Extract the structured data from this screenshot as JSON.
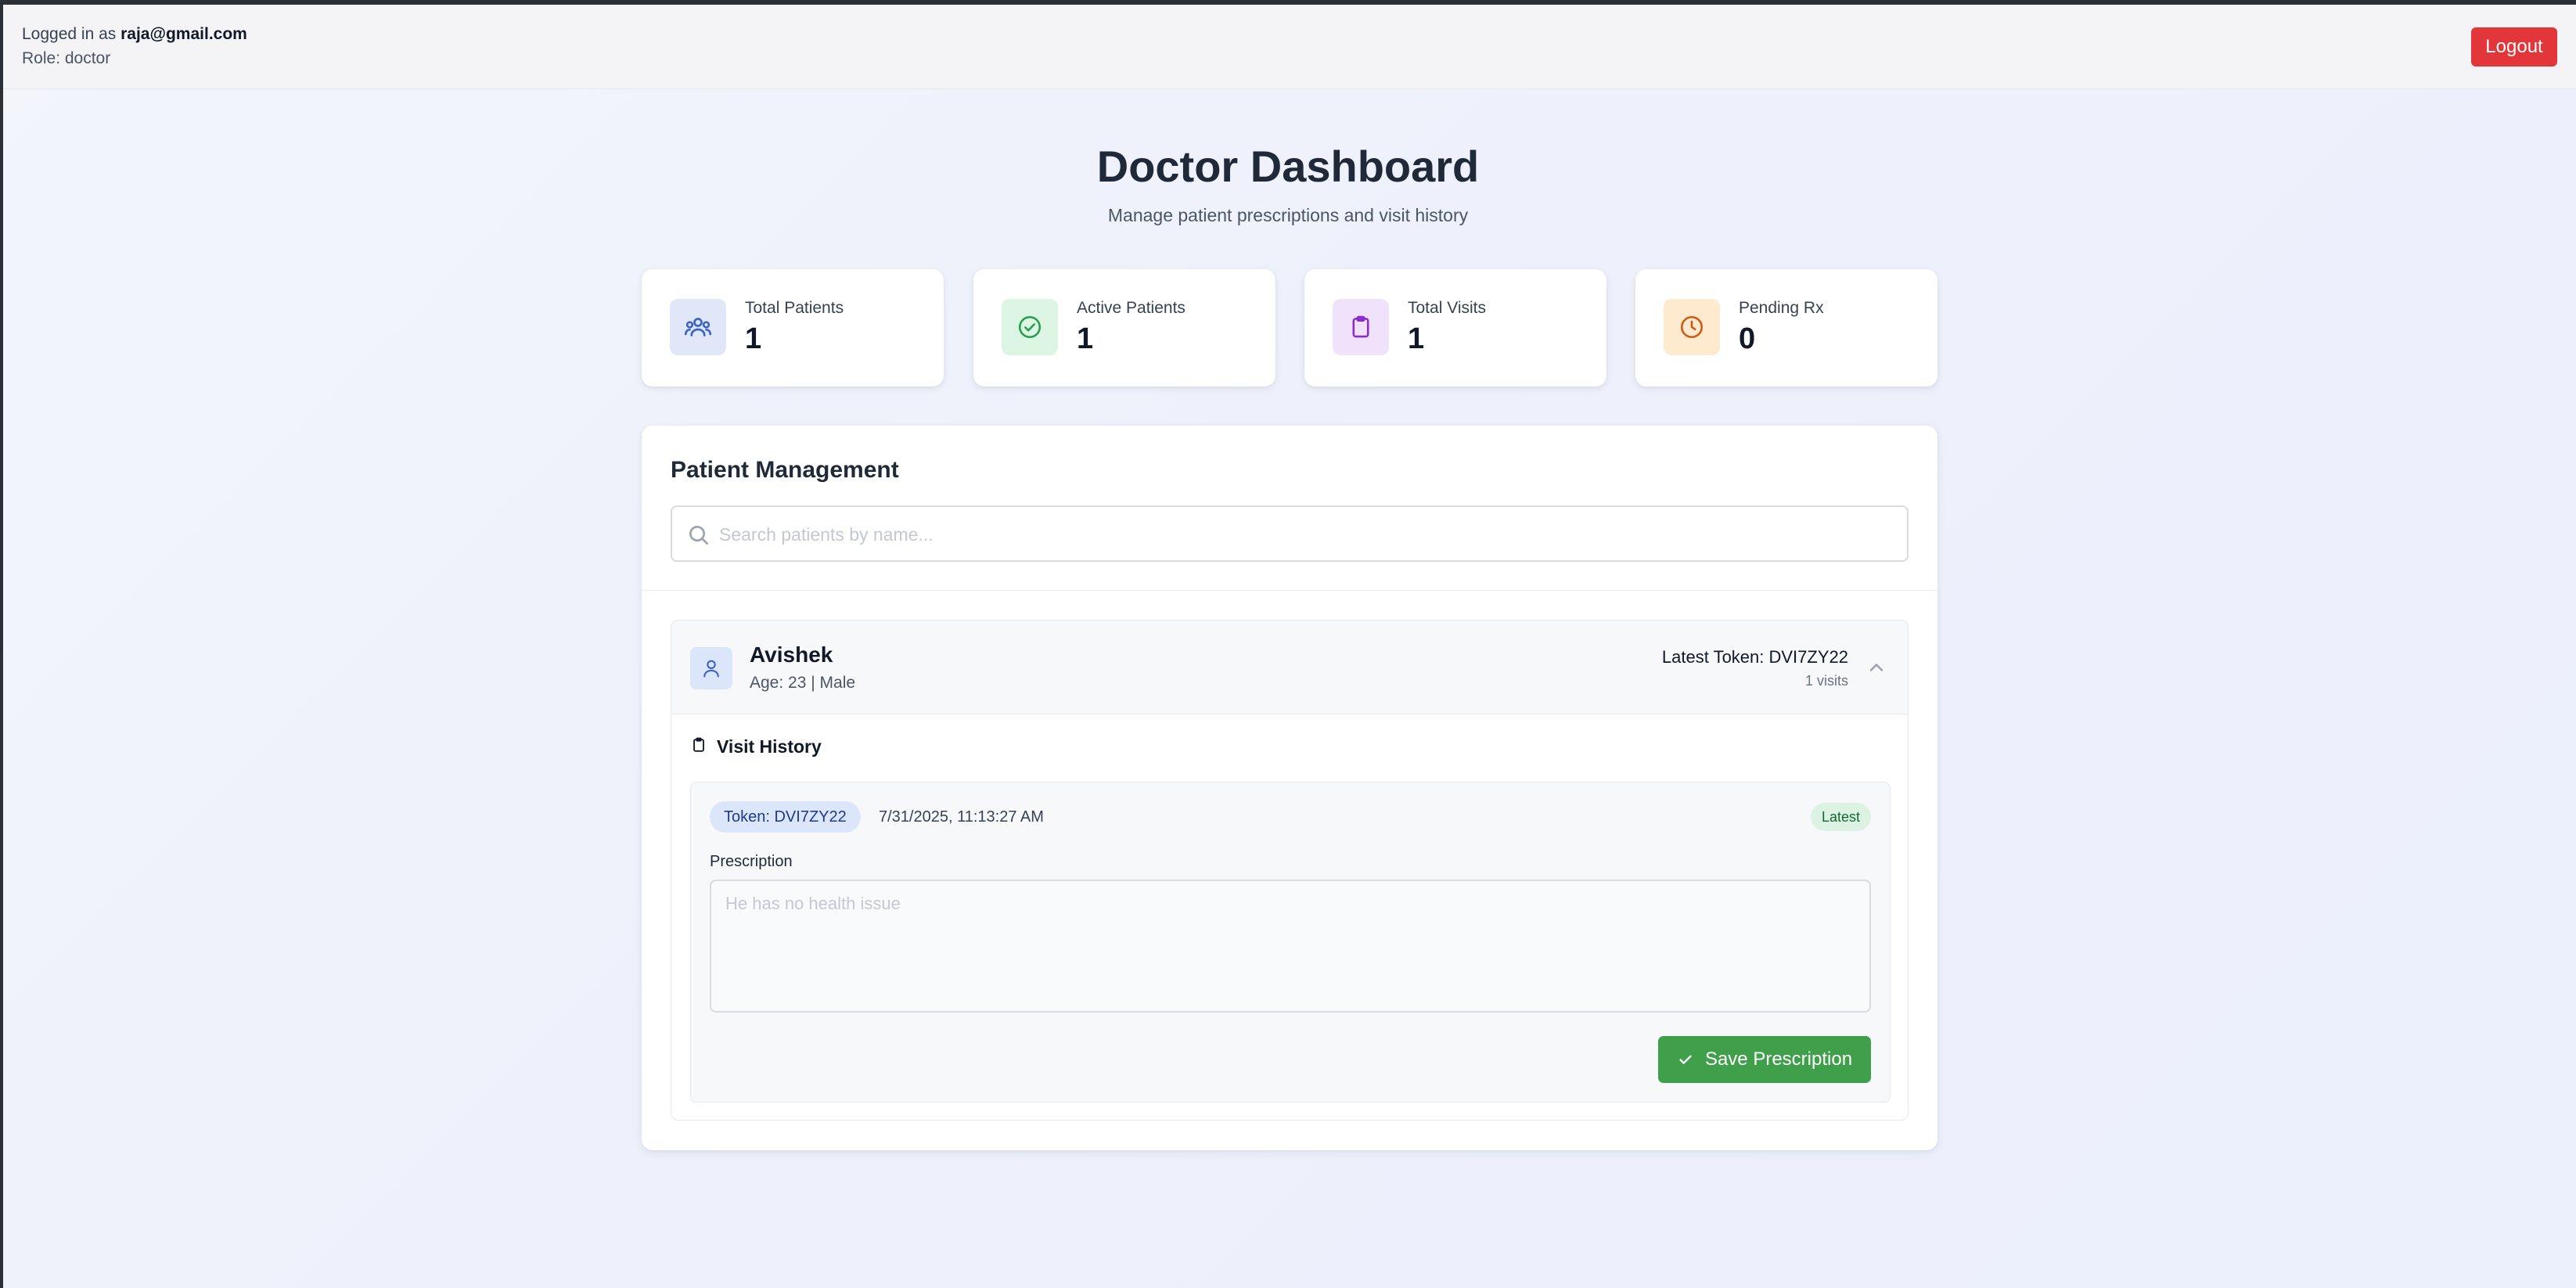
{
  "session": {
    "logged_in_prefix": "Logged in as",
    "email": "raja@gmail.com",
    "role_line": "Role: doctor",
    "logout_label": "Logout"
  },
  "header": {
    "title": "Doctor Dashboard",
    "subtitle": "Manage patient prescriptions and visit history"
  },
  "stats": [
    {
      "label": "Total Patients",
      "value": "1",
      "icon": "users-icon",
      "color": "#3b63c9",
      "bg": "#dfe7f8"
    },
    {
      "label": "Active Patients",
      "value": "1",
      "icon": "check-circle-icon",
      "color": "#22a04b",
      "bg": "#dcf6e3"
    },
    {
      "label": "Total Visits",
      "value": "1",
      "icon": "clipboard-icon",
      "color": "#8b2bd1",
      "bg": "#f0e2fb"
    },
    {
      "label": "Pending Rx",
      "value": "0",
      "icon": "clock-icon",
      "color": "#d5570c",
      "bg": "#fdeacf"
    }
  ],
  "patient_management": {
    "title": "Patient Management",
    "search": {
      "placeholder": "Search patients by name...",
      "value": ""
    },
    "patients": [
      {
        "name": "Avishek",
        "meta": "Age: 23 | Male",
        "latest_token": "Latest Token: DVI7ZY22",
        "visits_count": "1 visits",
        "visit_history_title": "Visit History",
        "visits": [
          {
            "token": "Token: DVI7ZY22",
            "datetime": "7/31/2025, 11:13:27 AM",
            "badge": "Latest",
            "prescription_label": "Prescription",
            "prescription_placeholder": "He has no health issue",
            "save_label": "Save Prescription"
          }
        ]
      }
    ]
  }
}
